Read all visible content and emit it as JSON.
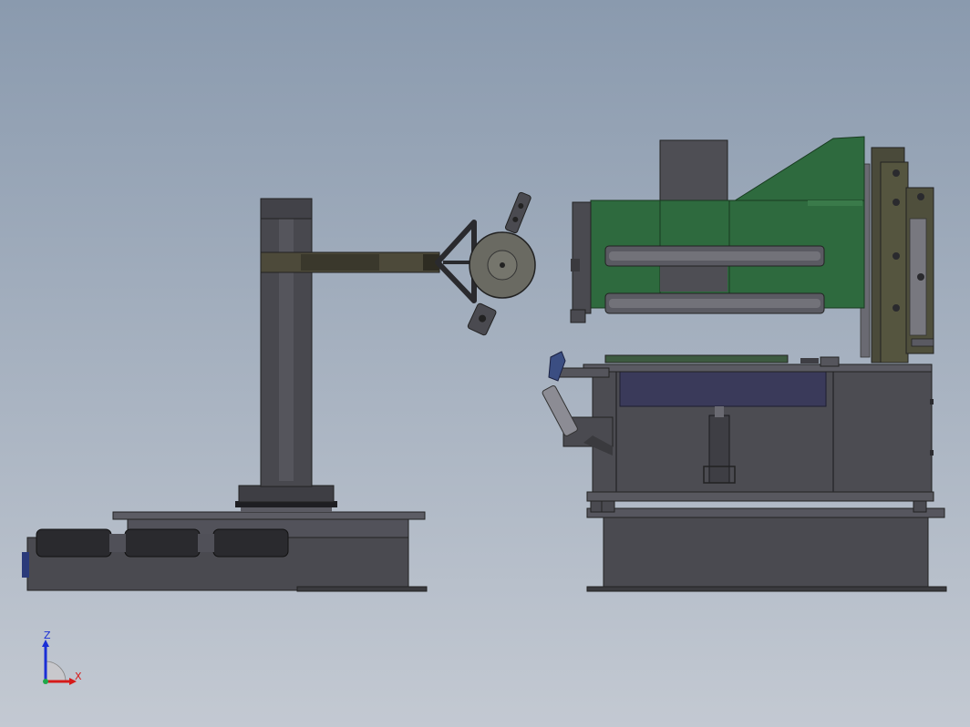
{
  "view": {
    "background_top": "#8a9aae",
    "background_bottom": "#c3c9d2"
  },
  "colors": {
    "steel_dark": "#3a3a3e",
    "steel_mid": "#4a4a50",
    "steel_light": "#606068",
    "olive_arm": "#4d4a3a",
    "green_frame": "#2e6a3e",
    "navy_tray": "#3a3a5a",
    "roller": "#2a2a2e"
  },
  "triad": {
    "z_label": "Z",
    "x_label": "X",
    "z_color": "#1a2fd6",
    "x_color": "#d61a1a",
    "origin_color": "#1fa84a"
  }
}
